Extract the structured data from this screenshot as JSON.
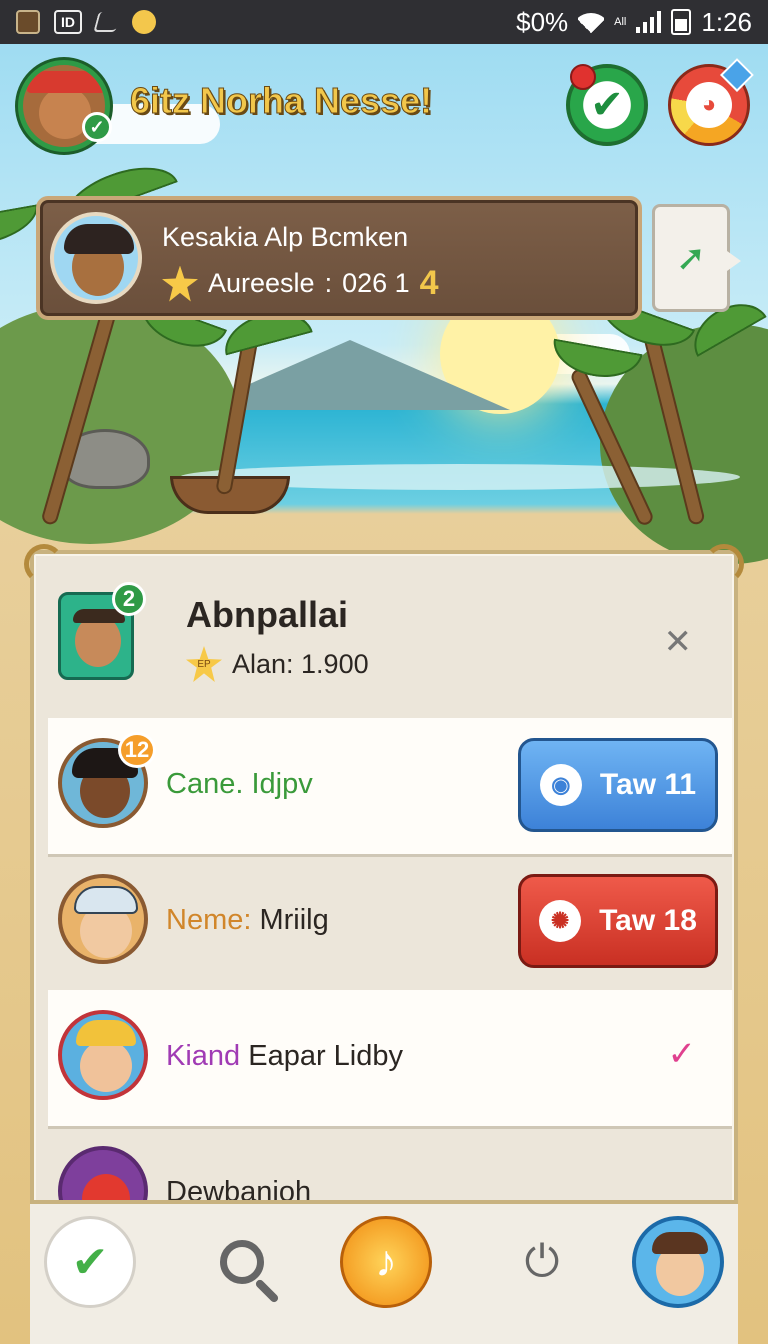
{
  "status_bar": {
    "left_icons": [
      "app-icon-1",
      "id-icon",
      "no-signal-icon",
      "character-icon"
    ],
    "left_text": "ID",
    "battery": "$0%",
    "signal_label": "All",
    "time": "1:26"
  },
  "header": {
    "title": "6itz Norha Nesse!",
    "check_button_icon": "checkmark-icon",
    "ring_button_icon": "character-ring-icon"
  },
  "profile_banner": {
    "name": "Kesakia Alp Bcmken",
    "stat_label": "Aureesle",
    "stat_sep": ":",
    "stat_value": "026 1",
    "stat_big": "4",
    "share_icon": "share-arrow-icon"
  },
  "panel": {
    "head": {
      "badge": "2",
      "name": "Abnpallai",
      "score": "Alan: 1.900",
      "star_text": "EP"
    },
    "rows": [
      {
        "level": "12",
        "label_a": "Cane. Idjpv",
        "label_b": "",
        "label_a_color": "#3a9a3a",
        "button": "Taw 11",
        "button_style": "blue"
      },
      {
        "level": "",
        "label_a": "Neme:",
        "label_b": "Mriilg",
        "label_a_color": "#d1862a",
        "button": "Taw 18",
        "button_style": "red"
      },
      {
        "level": "",
        "label_a": "Kiand",
        "label_b": "Eapar Lidby",
        "label_a_color": "#a03bb4",
        "button": "",
        "button_style": ""
      },
      {
        "level": "",
        "label_a": "Dewbanioh",
        "label_b": "",
        "label_a_color": "#2b2622",
        "button": "",
        "button_style": ""
      }
    ]
  },
  "bottom_nav": {
    "items": [
      "check-icon",
      "search-icon",
      "music-icon",
      "power-icon",
      "profile-icon"
    ]
  },
  "colors": {
    "accent_green": "#2f9a46",
    "accent_gold": "#f2c74b",
    "button_blue": "#3d82d8",
    "button_red": "#c93023"
  }
}
